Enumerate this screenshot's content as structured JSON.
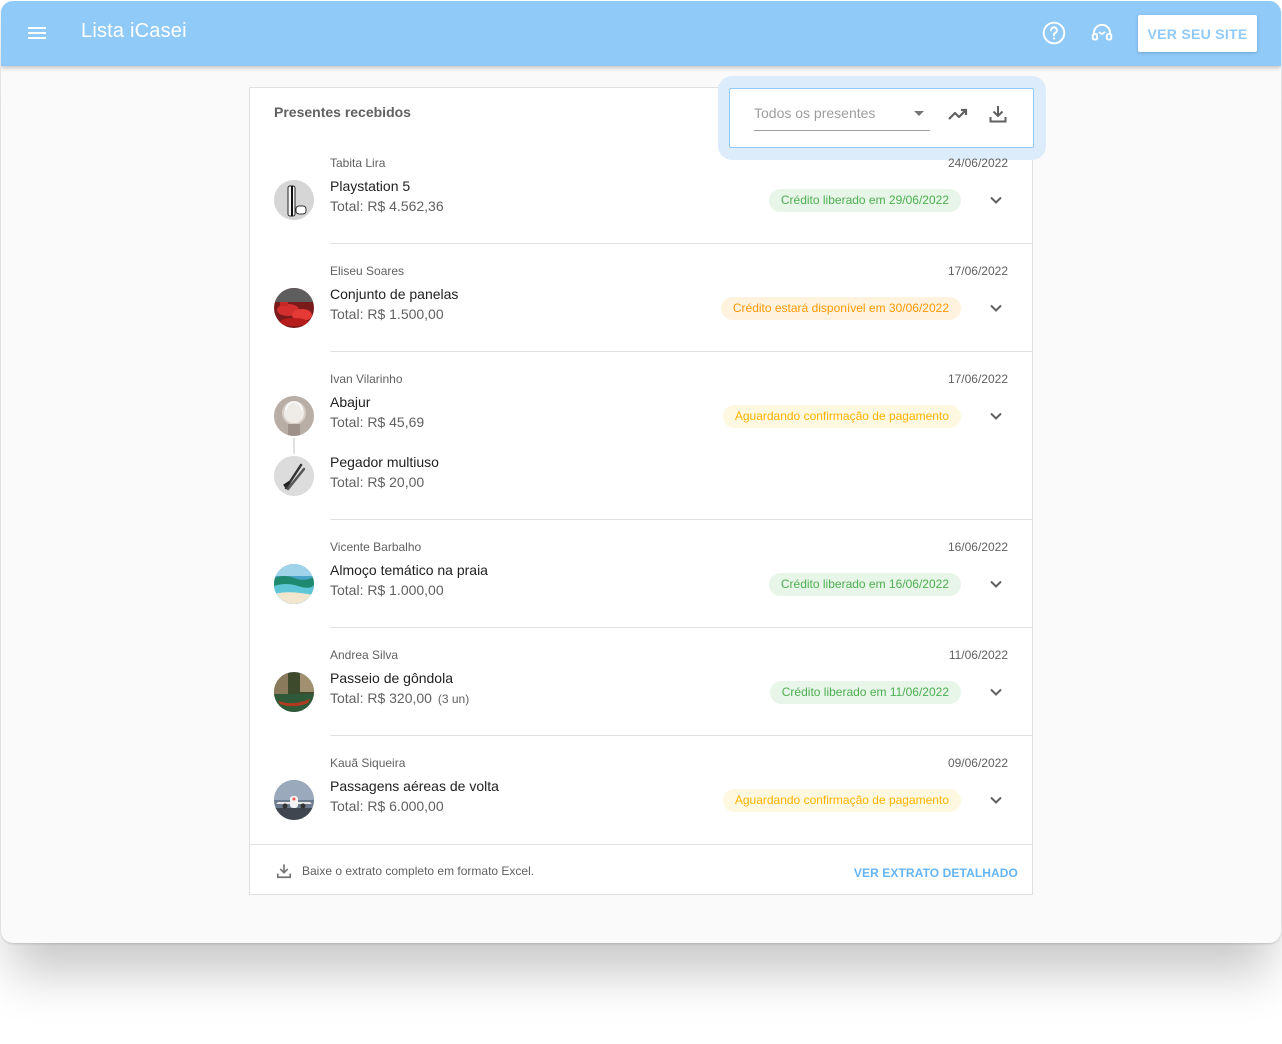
{
  "app": {
    "title": "Lista iCasei",
    "site_button": "VER SEU SITE"
  },
  "icons": {
    "menu": "menu-icon",
    "help": "help-circle-icon",
    "support": "headset-icon",
    "trend": "trending-up-icon",
    "download": "download-icon",
    "expand": "chevron-down-icon"
  },
  "card": {
    "title": "Presentes recebidos"
  },
  "filter": {
    "placeholder": "Todos os presentes"
  },
  "colors": {
    "appbar": "#90caf9",
    "accent": "#64b5f6",
    "green": "#4caf50",
    "orange": "#ff9800",
    "yellow": "#ffb300"
  },
  "entries": [
    {
      "giver": "Tabita Lira",
      "date": "24/06/2022",
      "status": "Crédito liberado em 29/06/2022",
      "status_color": "green",
      "items": [
        {
          "name": "Playstation 5",
          "total": "Total: R$ 4.562,36",
          "image": "playstation-image"
        }
      ]
    },
    {
      "giver": "Eliseu Soares",
      "date": "17/06/2022",
      "status": "Crédito estará disponível em 30/06/2022",
      "status_color": "orange",
      "items": [
        {
          "name": "Conjunto de panelas",
          "total": "Total: R$ 1.500,00",
          "image": "pans-image"
        }
      ]
    },
    {
      "giver": "Ivan Vilarinho",
      "date": "17/06/2022",
      "status": "Aguardando confirmação de pagamento",
      "status_color": "yellow",
      "items": [
        {
          "name": "Abajur",
          "total": "Total: R$ 45,69",
          "image": "lamp-image"
        },
        {
          "name": "Pegador multiuso",
          "total": "Total: R$ 20,00",
          "image": "tongs-image"
        }
      ]
    },
    {
      "giver": "Vicente Barbalho",
      "date": "16/06/2022",
      "status": "Crédito liberado em 16/06/2022",
      "status_color": "green",
      "items": [
        {
          "name": "Almoço temático na praia",
          "total": "Total: R$ 1.000,00",
          "image": "beach-image"
        }
      ]
    },
    {
      "giver": "Andrea Silva",
      "date": "11/06/2022",
      "status": "Crédito liberado em 11/06/2022",
      "status_color": "green",
      "items": [
        {
          "name": "Passeio de gôndola",
          "total": "Total: R$ 320,00",
          "qty": "(3 un)",
          "image": "gondola-image"
        }
      ]
    },
    {
      "giver": "Kauã Siqueira",
      "date": "09/06/2022",
      "status": "Aguardando confirmação de pagamento",
      "status_color": "yellow",
      "items": [
        {
          "name": "Passagens aéreas de volta",
          "total": "Total: R$ 6.000,00",
          "image": "airplane-image"
        }
      ]
    }
  ],
  "footer": {
    "text": "Baixe o extrato completo em formato Excel.",
    "link": "VER EXTRATO DETALHADO"
  }
}
